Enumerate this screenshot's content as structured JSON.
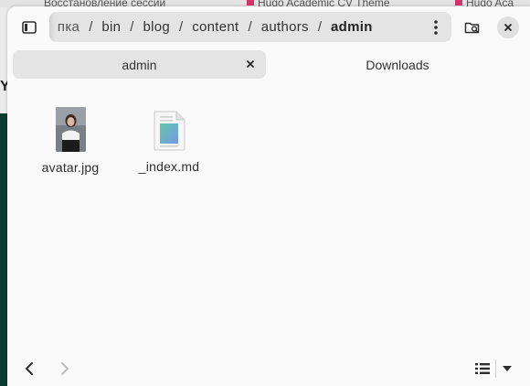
{
  "background": {
    "tabs": [
      {
        "label": "Восстановление сессии"
      },
      {
        "label": "Hugo Academic CV Theme"
      },
      {
        "label": "Hugo Aca"
      }
    ],
    "letter": "Y"
  },
  "header": {
    "path": [
      {
        "label": ". пка"
      },
      {
        "label": "bin"
      },
      {
        "label": "blog"
      },
      {
        "label": "content"
      },
      {
        "label": "authors"
      },
      {
        "label": "admin"
      }
    ],
    "separator": "/"
  },
  "tabs": [
    {
      "label": "admin",
      "active": true
    },
    {
      "label": "Downloads",
      "active": false
    }
  ],
  "files": [
    {
      "name": "avatar.jpg",
      "type": "image"
    },
    {
      "name": "_index.md",
      "type": "text"
    }
  ],
  "icons": {
    "sidebar": "sidebar-toggle-icon",
    "menu": "kebab-menu-icon",
    "search": "folder-search-icon",
    "close": "close-icon",
    "back": "chevron-left-icon",
    "forward": "chevron-right-icon",
    "view": "list-view-icon"
  },
  "colors": {
    "window_bg": "#fafafa",
    "pathbar_bg": "#e4e4e4",
    "text": "#333333"
  }
}
